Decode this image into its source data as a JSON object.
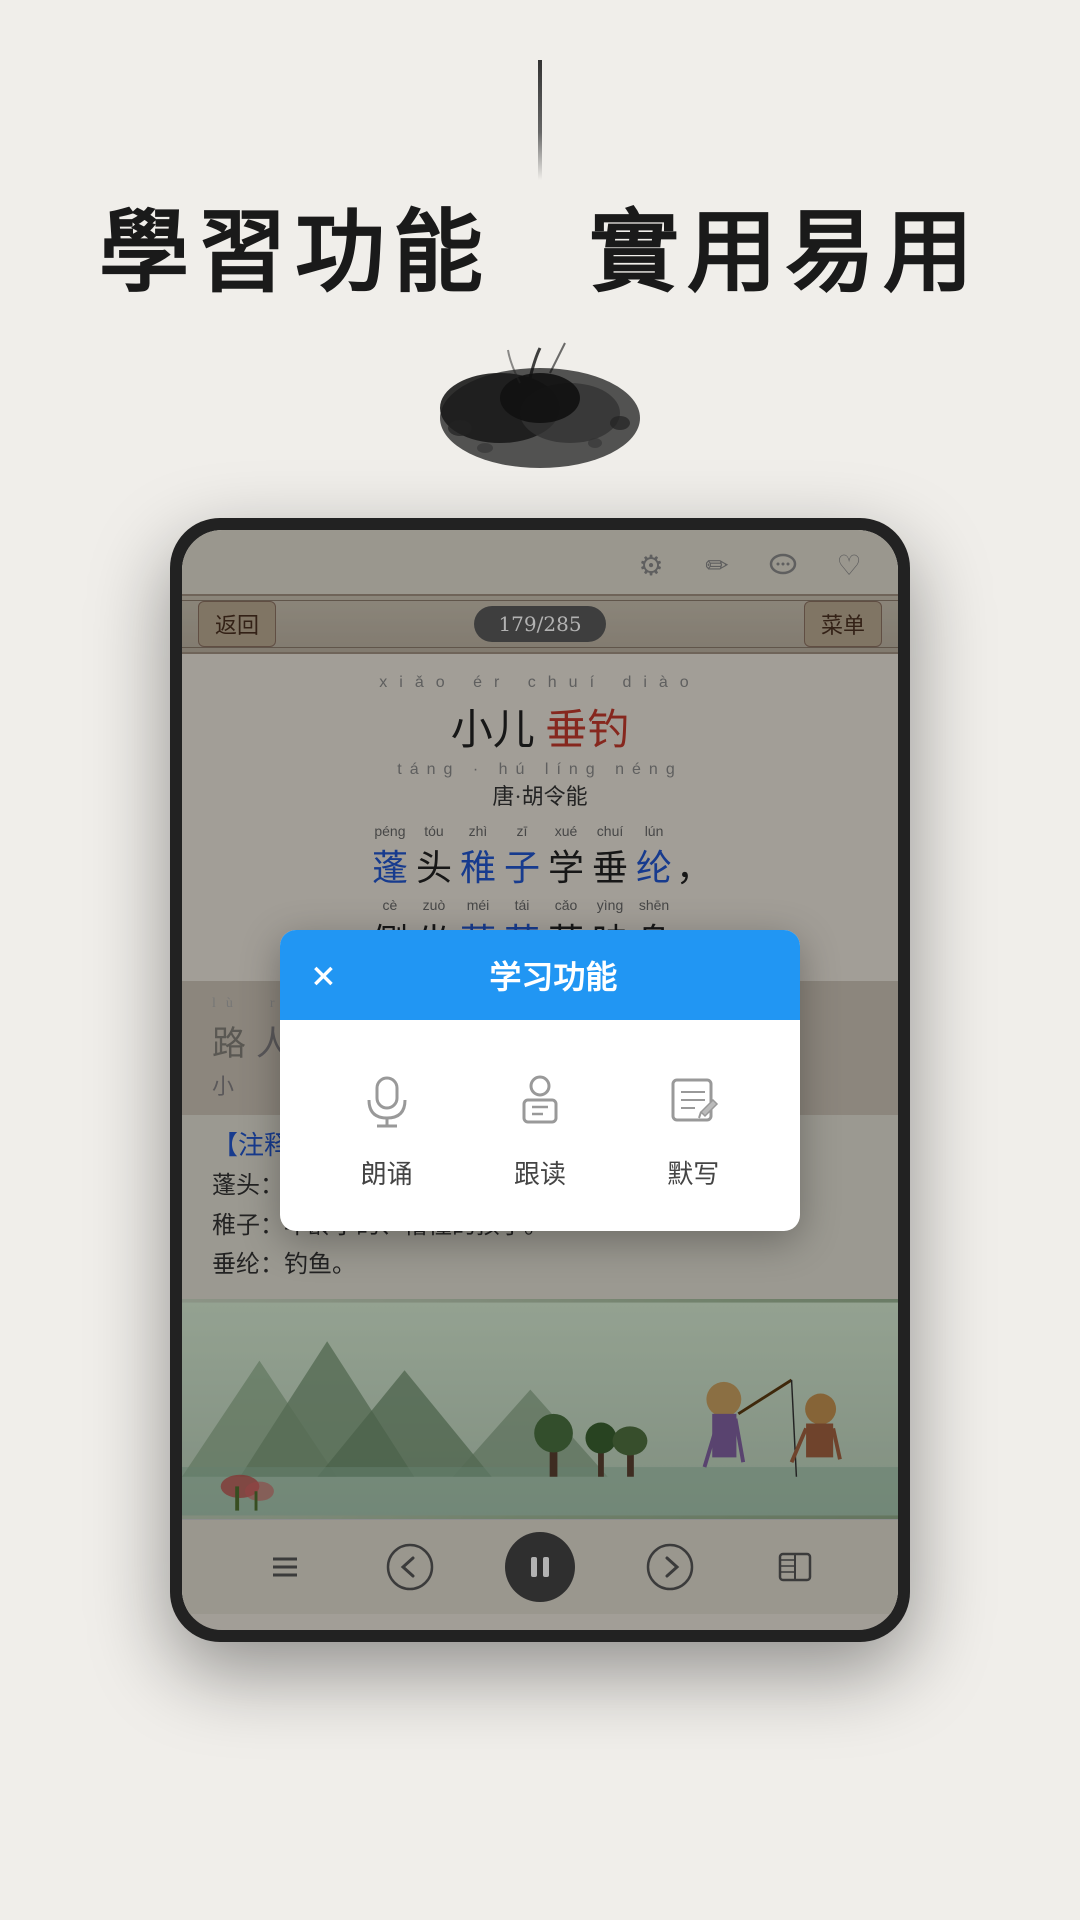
{
  "page": {
    "background_color": "#f0eeea"
  },
  "header": {
    "title": "學習功能　實用易用",
    "title_color": "#1a1a1a"
  },
  "nav": {
    "back_label": "返回",
    "page_indicator": "179/285",
    "menu_label": "菜单"
  },
  "poem": {
    "title_pinyin": "xiǎo  ér  chuí  diào",
    "title": "小儿垂钓",
    "title_plain": "小儿",
    "title_highlight": "垂钓",
    "author_pinyin": "táng · hú  líng  néng",
    "author": "唐·胡令能",
    "lines": [
      {
        "chars": [
          {
            "pinyin": "péng",
            "text": "蓬",
            "color": "blue"
          },
          {
            "pinyin": "tóu",
            "text": "头",
            "color": "black"
          },
          {
            "pinyin": "zhì",
            "text": "稚",
            "color": "blue"
          },
          {
            "pinyin": "zī",
            "text": "子",
            "color": "blue"
          },
          {
            "pinyin": "xué",
            "text": "学",
            "color": "black"
          },
          {
            "pinyin": "chuí",
            "text": "垂",
            "color": "black"
          },
          {
            "pinyin": "lún",
            "text": "纶",
            "color": "blue"
          },
          {
            "text": "，",
            "color": "black"
          }
        ]
      },
      {
        "chars": [
          {
            "pinyin": "cè",
            "text": "侧",
            "color": "black"
          },
          {
            "pinyin": "zuò",
            "text": "坐",
            "color": "black"
          },
          {
            "pinyin": "méi",
            "text": "莓",
            "color": "blue"
          },
          {
            "pinyin": "tái",
            "text": "苔",
            "color": "blue"
          },
          {
            "pinyin": "cǎo",
            "text": "草",
            "color": "black"
          },
          {
            "pinyin": "yìng",
            "text": "映",
            "color": "black"
          },
          {
            "pinyin": "shēn",
            "text": "身",
            "color": "black"
          },
          {
            "text": "。",
            "color": "black"
          }
        ]
      }
    ],
    "line3_prefix": "路",
    "line4_prefix": "小"
  },
  "annotations": {
    "header": "【注释】",
    "items": [
      {
        "label": "蓬头：",
        "desc": ""
      },
      {
        "label": "稚子：",
        "desc": "年龄小的、懵懂的孩子。"
      },
      {
        "label": "垂纶：",
        "desc": "钓鱼。"
      }
    ]
  },
  "dialog": {
    "title": "学习功能",
    "close_label": "×",
    "items": [
      {
        "icon": "microphone",
        "label": "朗诵"
      },
      {
        "icon": "reading",
        "label": "跟读"
      },
      {
        "icon": "writing",
        "label": "默写"
      }
    ]
  },
  "bottom_nav": {
    "prev_label": "←",
    "pause_label": "⏸",
    "next_label": "→",
    "book_label": "📖"
  },
  "icons": {
    "gear": "⚙",
    "pen": "✏",
    "chat": "💬",
    "heart": "♡"
  }
}
